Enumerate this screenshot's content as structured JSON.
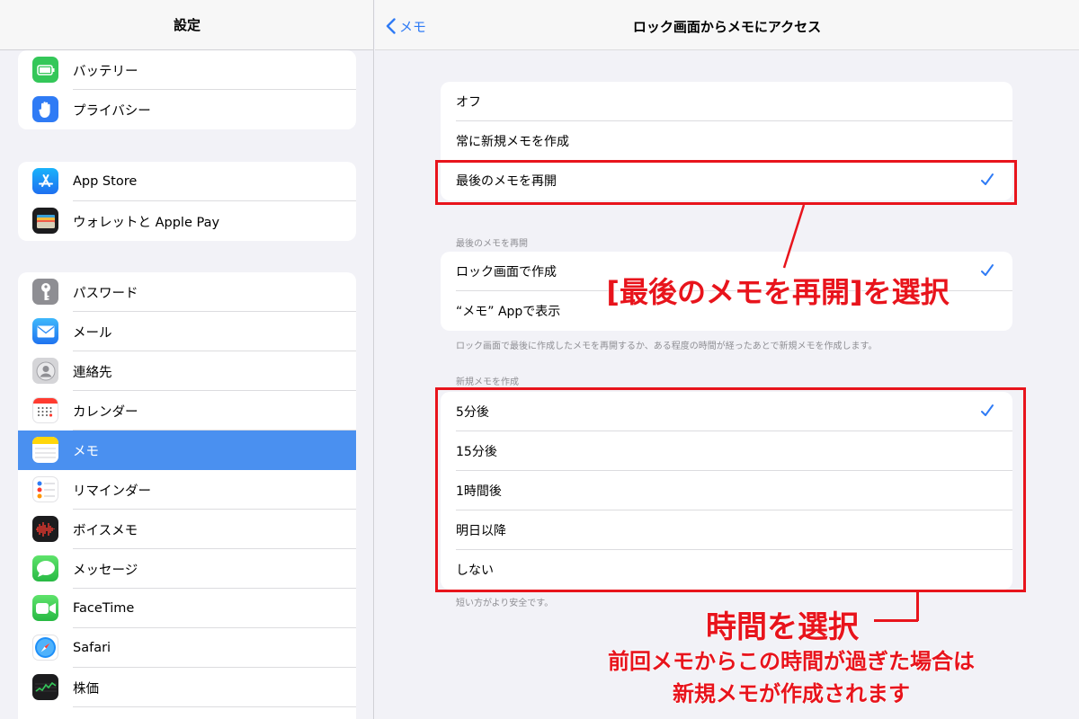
{
  "sidebar": {
    "title": "設定",
    "groups": [
      [
        {
          "label": "バッテリー",
          "icon": "battery-icon",
          "color": "#34c759"
        },
        {
          "label": "プライバシー",
          "icon": "hand-icon",
          "color": "#2f7bf5"
        }
      ],
      [
        {
          "label": "App Store",
          "icon": "app-store-icon",
          "color": "#1e8ff8"
        },
        {
          "label": "ウォレットと Apple Pay",
          "icon": "wallet-icon",
          "color": "#1c1c1e"
        }
      ],
      [
        {
          "label": "パスワード",
          "icon": "key-icon",
          "color": "#8e8e93"
        },
        {
          "label": "メール",
          "icon": "mail-icon",
          "color": "#2f9bf5"
        },
        {
          "label": "連絡先",
          "icon": "contacts-icon",
          "color": "#c7c7cc"
        },
        {
          "label": "カレンダー",
          "icon": "calendar-icon",
          "color": "#ffffff"
        },
        {
          "label": "メモ",
          "icon": "notes-icon",
          "color": "#ffd60a",
          "selected": true
        },
        {
          "label": "リマインダー",
          "icon": "reminders-icon",
          "color": "#ffffff"
        },
        {
          "label": "ボイスメモ",
          "icon": "voice-memo-icon",
          "color": "#1c1c1e"
        },
        {
          "label": "メッセージ",
          "icon": "messages-icon",
          "color": "#34c759"
        },
        {
          "label": "FaceTime",
          "icon": "facetime-icon",
          "color": "#34c759"
        },
        {
          "label": "Safari",
          "icon": "safari-icon",
          "color": "#ffffff"
        },
        {
          "label": "株価",
          "icon": "stocks-icon",
          "color": "#1c1c1e"
        }
      ]
    ]
  },
  "detail": {
    "back_label": "メモ",
    "title": "ロック画面からメモにアクセス",
    "access_options": [
      {
        "label": "オフ",
        "checked": false
      },
      {
        "label": "常に新規メモを作成",
        "checked": false
      },
      {
        "label": "最後のメモを再開",
        "checked": true
      }
    ],
    "resume_header": "最後のメモを再開",
    "resume_options": [
      {
        "label": "ロック画面で作成",
        "checked": true
      },
      {
        "label": "“メモ” Appで表示",
        "checked": false
      }
    ],
    "resume_footer": "ロック画面で最後に作成したメモを再開するか、ある程度の時間が経ったあとで新規メモを作成します。",
    "new_header": "新規メモを作成",
    "new_options": [
      {
        "label": "5分後",
        "checked": true
      },
      {
        "label": "15分後",
        "checked": false
      },
      {
        "label": "1時間後",
        "checked": false
      },
      {
        "label": "明日以降",
        "checked": false
      },
      {
        "label": "しない",
        "checked": false
      }
    ],
    "new_footer": "短い方がより安全です。"
  },
  "annotations": {
    "callout_1": "[最後のメモを再開]を選択",
    "callout_2_title": "時間を選択",
    "callout_2_line1": "前回メモからこの時間が過ぎた場合は",
    "callout_2_line2": "新規メモが作成されます"
  },
  "colors": {
    "accent": "#2f7bf5",
    "annotation": "#e8141c",
    "selection": "#4a90f0"
  }
}
